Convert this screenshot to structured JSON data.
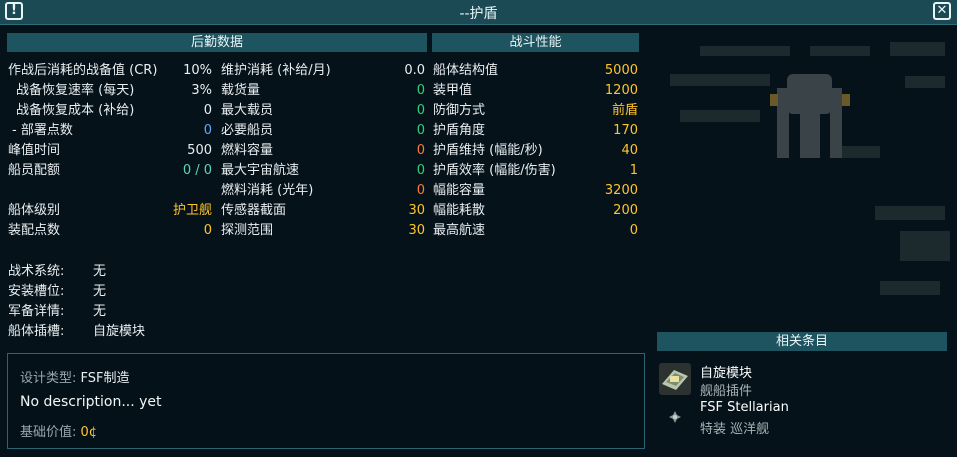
{
  "window": {
    "title": "--护盾"
  },
  "headers": {
    "logistics": "后勤数据",
    "combat": "战斗性能",
    "related": "相关条目"
  },
  "logistics_left": [
    {
      "label": "作战后消耗的战备值 (CR)",
      "value": "10%",
      "color": "white"
    },
    {
      "label": "  战备恢复速率 (每天)",
      "value": "3%",
      "color": "white"
    },
    {
      "label": "  战备恢复成本 (补给)",
      "value": "0",
      "color": "white"
    },
    {
      "label": " - 部署点数",
      "value": "0",
      "color": "blue"
    },
    {
      "label": "峰值时间",
      "value": "500",
      "color": "white"
    },
    {
      "label": "船员配额",
      "value": "0 / 0",
      "color": "teal"
    },
    {
      "label": "",
      "value": "",
      "color": "white"
    },
    {
      "label": "船体级别",
      "value": "护卫舰",
      "color": "yellow"
    },
    {
      "label": "装配点数",
      "value": "0",
      "color": "yellow"
    }
  ],
  "logistics_right": [
    {
      "label": "维护消耗 (补给/月)",
      "value": "0.0",
      "color": "white"
    },
    {
      "label": "载货量",
      "value": "0",
      "color": "green"
    },
    {
      "label": "最大载员",
      "value": "0",
      "color": "green"
    },
    {
      "label": "必要船员",
      "value": "0",
      "color": "green"
    },
    {
      "label": "燃料容量",
      "value": "0",
      "color": "orange"
    },
    {
      "label": "最大宇宙航速",
      "value": "0",
      "color": "green"
    },
    {
      "label": "燃料消耗 (光年)",
      "value": "0",
      "color": "orange"
    },
    {
      "label": "传感器截面",
      "value": "30",
      "color": "yellow"
    },
    {
      "label": "探测范围",
      "value": "30",
      "color": "yellow"
    }
  ],
  "combat": [
    {
      "label": "船体结构值",
      "value": "5000",
      "color": "yellow"
    },
    {
      "label": "装甲值",
      "value": "1200",
      "color": "yellow"
    },
    {
      "label": "防御方式",
      "value": "前盾",
      "color": "yellow"
    },
    {
      "label": "护盾角度",
      "value": "170",
      "color": "yellow"
    },
    {
      "label": "护盾维持 (幅能/秒)",
      "value": "40",
      "color": "yellow"
    },
    {
      "label": "护盾效率 (幅能/伤害)",
      "value": "1",
      "color": "yellow"
    },
    {
      "label": "幅能容量",
      "value": "3200",
      "color": "yellow"
    },
    {
      "label": "幅能耗散",
      "value": "200",
      "color": "yellow"
    },
    {
      "label": "最高航速",
      "value": "0",
      "color": "yellow"
    }
  ],
  "systems": [
    {
      "label": "战术系统:",
      "value": "无"
    },
    {
      "label": "安装槽位:",
      "value": "无"
    },
    {
      "label": "军备详情:",
      "value": "无"
    },
    {
      "label": "船体插槽:",
      "value": "自旋模块"
    }
  ],
  "description": {
    "design_label": "设计类型: ",
    "design_value": "FSF制造",
    "text": "No description... yet",
    "base_value_label": "基础价值: ",
    "base_value": "0¢"
  },
  "related": [
    {
      "title": "自旋模块",
      "subtitle": "舰船插件",
      "icon": "spin-module-icon"
    },
    {
      "title": "FSF Stellarian",
      "subtitle": "特装 巡洋舰",
      "icon": "ship-marker-icon"
    }
  ],
  "colors": {
    "white": "#e9eef0",
    "green": "#2fd27a",
    "blue": "#62a8ff",
    "orange": "#ff7a33",
    "yellow": "#ffc42b",
    "teal": "#59d6c2",
    "header_bg": "#1e5360",
    "title_bg": "#1b4a55"
  }
}
